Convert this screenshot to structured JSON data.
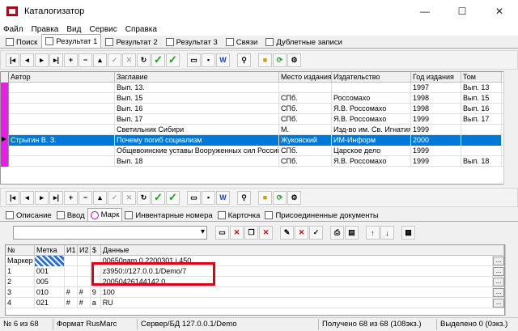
{
  "window": {
    "title": "Каталогизатор",
    "minimize": "—",
    "maximize": "☐",
    "close": "✕"
  },
  "menu": [
    "Файл",
    "Правка",
    "Вид",
    "Сервис",
    "Справка"
  ],
  "tabs": [
    "Поиск",
    "Результат 1",
    "Результат 2",
    "Результат 3",
    "Связи",
    "Дублетные записи"
  ],
  "results": {
    "columns": [
      "Автор",
      "Заглавие",
      "Место издания",
      "Издательство",
      "Год издания",
      "Том"
    ],
    "rows": [
      [
        "",
        "Вып. 13.",
        "",
        "",
        "1997",
        "Вып. 13"
      ],
      [
        "",
        "Вып. 15",
        "СПб.",
        "Россомахо",
        "1998",
        "Вып. 15"
      ],
      [
        "",
        "Вып. 16",
        "СПб.",
        "Я.В. Россомахо",
        "1998",
        "Вып. 16"
      ],
      [
        "",
        "Вып. 17",
        "СПб.",
        "Я.В. Россомахо",
        "1999",
        "Вып. 17"
      ],
      [
        "",
        "Светильник Сибири",
        "М.",
        "Изд-во им. Св. Игнатия",
        "1999",
        ""
      ],
      [
        "Стрыгин В. З.",
        "Почему погиб социализм",
        "Жуковский",
        "ИМ-Информ",
        "2000",
        ""
      ],
      [
        "",
        "Общевоинские уставы Вооруженных сил Российской",
        "СПб.",
        "Царское дело",
        "1999",
        ""
      ],
      [
        "",
        "Вып. 18",
        "СПб.",
        "Я.В. Россомахо",
        "1999",
        "Вып. 18"
      ]
    ]
  },
  "subtabs": [
    "Описание",
    "Ввод",
    "Марк",
    "Инвентарные номера",
    "Карточка",
    "Присоединенные документы"
  ],
  "marc": {
    "columns": [
      "№",
      "Метка",
      "И1",
      "И2",
      "$",
      "Данные"
    ],
    "rows": [
      [
        "Маркер",
        "",
        "",
        "",
        "",
        "00650nam 0 2200301 i 450"
      ],
      [
        "1",
        "001",
        "",
        "",
        "",
        "z3950://127.0.0.1/Demo/7"
      ],
      [
        "2",
        "005",
        "",
        "",
        "",
        "20050426144142.0"
      ],
      [
        "3",
        "010",
        "#",
        "#",
        "9",
        "100"
      ],
      [
        "4",
        "021",
        "#",
        "#",
        "a",
        "RU"
      ]
    ]
  },
  "status": [
    "№ 6 из 68",
    "Формат RusMarc",
    "Сервер/БД 127.0.0.1/Demo",
    "Получено 68 из 68 (108экз.)",
    "Выделено 0 (0экз.)"
  ]
}
